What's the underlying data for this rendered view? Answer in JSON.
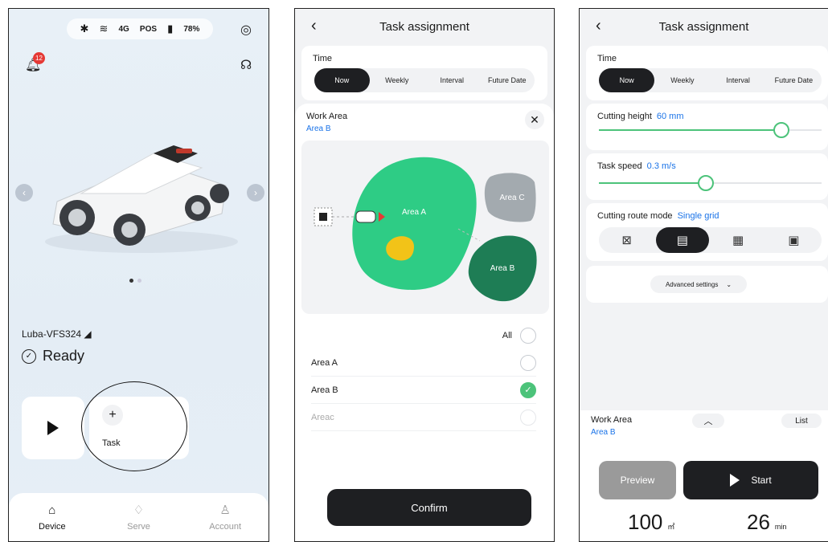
{
  "screen1": {
    "status": {
      "battery": "78%",
      "network": "4G",
      "pos": "POS"
    },
    "notification_count": "12",
    "device_name": "Luba-VFS324",
    "status_text": "Ready",
    "task_label": "Task",
    "nav": [
      {
        "label": "Device",
        "icon": "home-icon",
        "active": true
      },
      {
        "label": "Serve",
        "icon": "diamond-icon",
        "active": false
      },
      {
        "label": "Account",
        "icon": "person-icon",
        "active": false
      }
    ]
  },
  "screen2": {
    "title": "Task assignment",
    "time_label": "Time",
    "time_options": [
      "Now",
      "Weekly",
      "Interval",
      "Future Date"
    ],
    "time_selected": "Now",
    "work_area_label": "Work Area",
    "work_area_value": "Area B",
    "map_labels": {
      "a": "Area A",
      "b": "Area B",
      "c": "Area C"
    },
    "all_label": "All",
    "areas": [
      {
        "name": "Area A",
        "checked": false,
        "enabled": true
      },
      {
        "name": "Area B",
        "checked": true,
        "enabled": true
      },
      {
        "name": "Areac",
        "checked": false,
        "enabled": false
      }
    ],
    "confirm_label": "Confirm",
    "colors": {
      "area_a": "#2ecc85",
      "area_b": "#1e7d55",
      "area_c": "#a3aaaf",
      "obstacle": "#f2c318",
      "check": "#4cc37a"
    }
  },
  "screen3": {
    "title": "Task assignment",
    "time_label": "Time",
    "time_options": [
      "Now",
      "Weekly",
      "Interval",
      "Future Date"
    ],
    "time_selected": "Now",
    "cutting_height_label": "Cutting height",
    "cutting_height_value": "60 mm",
    "cutting_height_fraction": 0.82,
    "task_speed_label": "Task speed",
    "task_speed_value": "0.3 m/s",
    "task_speed_fraction": 0.48,
    "route_label": "Cutting route mode",
    "route_value": "Single grid",
    "route_modes": [
      "zigzag-icon",
      "single-grid-icon",
      "double-grid-icon",
      "perimeter-icon"
    ],
    "route_selected_index": 1,
    "advanced_label": "Advanced settings",
    "work_area_label": "Work Area",
    "work_area_value": "Area B",
    "list_label": "List",
    "preview_label": "Preview",
    "start_label": "Start",
    "area_value": "100",
    "area_unit": "㎡",
    "time_value": "26",
    "time_unit": "min"
  }
}
